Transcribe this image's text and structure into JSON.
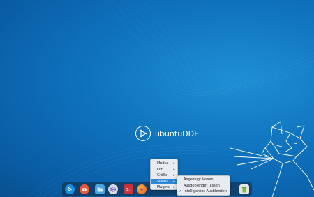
{
  "desktop": {
    "logo_text": "ubuntuDDE",
    "accent": "#0f72bd"
  },
  "dock": {
    "items": [
      {
        "name": "launcher-icon",
        "color": "#1d8fe1"
      },
      {
        "name": "screenshot-icon",
        "color": "#e8593b"
      },
      {
        "name": "file-manager-icon",
        "color": "#4aa3df"
      },
      {
        "name": "settings-icon",
        "color": "#d9dde3"
      },
      {
        "name": "terminal-icon",
        "color": "#c8323a"
      },
      {
        "name": "firefox-icon",
        "color": "#f07a1c"
      },
      {
        "name": "trash-icon",
        "color": "#e6e6e6"
      }
    ]
  },
  "context_menu": {
    "items": [
      {
        "label": "Modus",
        "has_submenu": true
      },
      {
        "label": "Ort",
        "has_submenu": true
      },
      {
        "label": "Größe",
        "has_submenu": true
      },
      {
        "label": "Status",
        "has_submenu": true,
        "active": true
      },
      {
        "label": "Plugins",
        "has_submenu": true
      }
    ]
  },
  "status_submenu": {
    "items": [
      {
        "label": "Angezeigt lassen",
        "checked": false
      },
      {
        "label": "Ausgeblendet lassen",
        "checked": false
      },
      {
        "label": "Intelligentes Ausblenden",
        "checked": true
      }
    ],
    "check_glyph": "✓"
  }
}
